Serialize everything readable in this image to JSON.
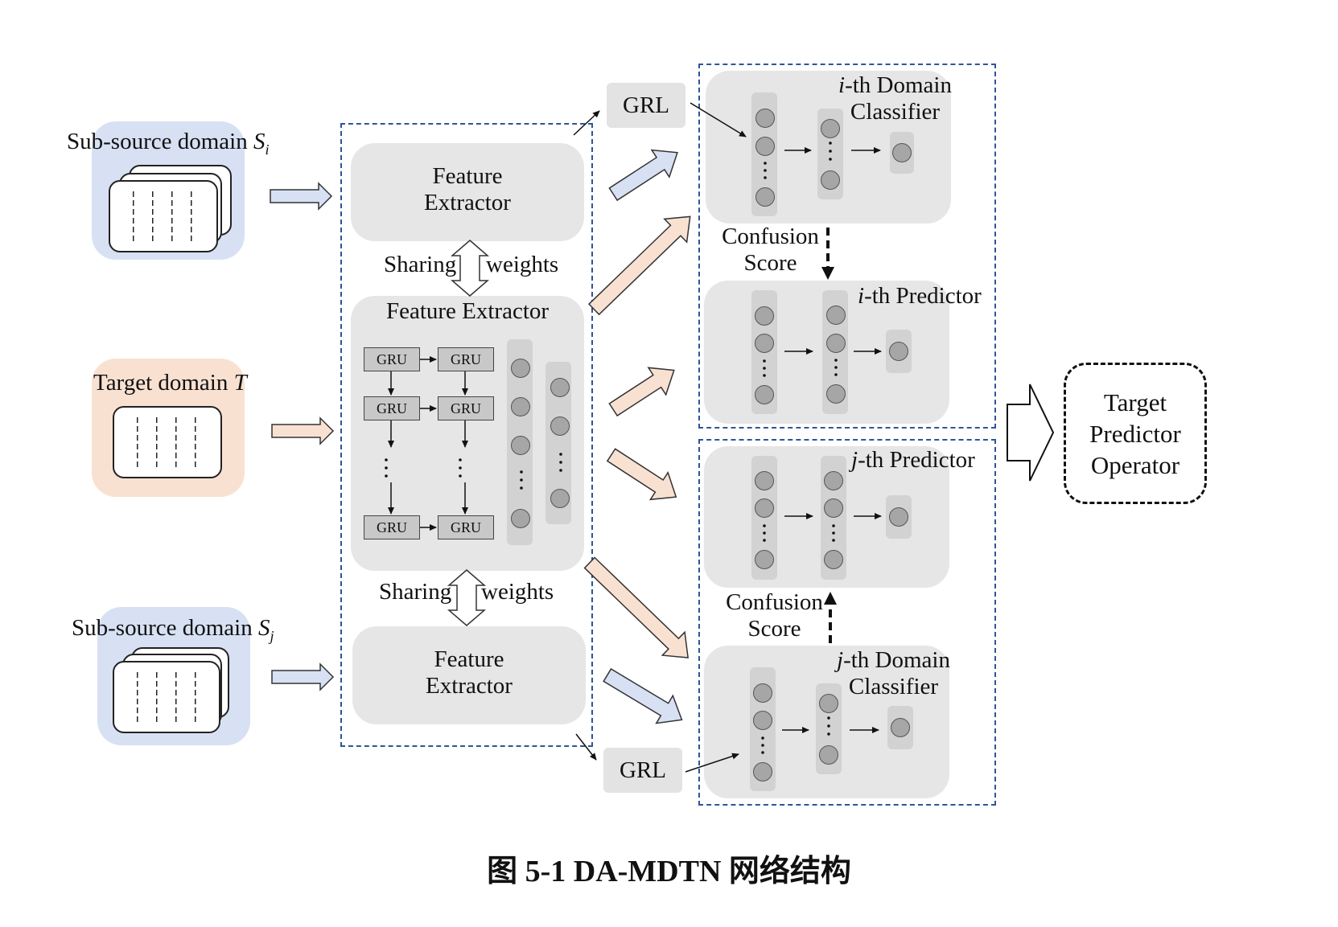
{
  "diagram": {
    "sources": {
      "si_label": "Sub-source domain ",
      "si_sym": "S",
      "si_sub": "i",
      "target_label": "Target domain ",
      "target_sym": "T",
      "sj_label": "Sub-source domain ",
      "sj_sym": "S",
      "sj_sub": "j"
    },
    "extractor": {
      "top_line1": "Feature",
      "top_line2": "Extractor",
      "middle_title": "Feature Extractor",
      "bottom_line1": "Feature",
      "bottom_line2": "Extractor",
      "sharing": "Sharing",
      "weights": "weights",
      "gru": "GRU"
    },
    "grl": "GRL",
    "i_classifier": {
      "index": "i",
      "line1": "-th Domain",
      "line2": "Classifier"
    },
    "i_predictor": {
      "index": "i",
      "text": "-th Predictor"
    },
    "j_predictor": {
      "index": "j",
      "text": "-th Predictor"
    },
    "j_classifier": {
      "index": "j",
      "line1": "-th Domain",
      "line2": "Classifier"
    },
    "confusion": {
      "line1": "Confusion",
      "line2": "Score"
    },
    "target_operator": {
      "line1": "Target",
      "line2": "Predictor",
      "line3": "Operator"
    },
    "colors": {
      "source": "#d7e1f3",
      "target": "#f9e1d2",
      "module": "#e6e6e6",
      "dashed_border": "#2f5597"
    }
  },
  "caption": "图 5-1 DA-MDTN 网络结构"
}
